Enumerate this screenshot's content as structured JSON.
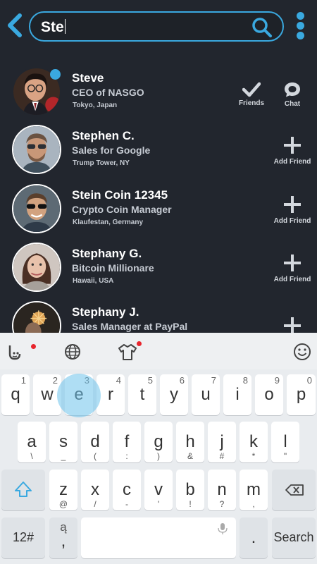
{
  "search": {
    "value": "Ste"
  },
  "contacts": [
    {
      "name": "Steve",
      "title": "CEO of NASGO",
      "location": "Tokyo, Japan",
      "actions": [
        {
          "icon": "check-icon",
          "label": "Friends"
        },
        {
          "icon": "chat-bubble-icon",
          "label": "Chat"
        }
      ],
      "online": true
    },
    {
      "name": "Stephen C.",
      "title": "Sales for Google",
      "location": "Trump Tower, NY",
      "actions": [
        {
          "icon": "plus-icon",
          "label": "Add Friend"
        }
      ]
    },
    {
      "name": "Stein Coin 12345",
      "title": "Crypto Coin Manager",
      "location": "Klaufestan, Germany",
      "actions": [
        {
          "icon": "plus-icon",
          "label": "Add Friend"
        }
      ]
    },
    {
      "name": "Stephany G.",
      "title": "Bitcoin Millionare",
      "location": "Hawaii, USA",
      "actions": [
        {
          "icon": "plus-icon",
          "label": "Add Friend"
        }
      ]
    },
    {
      "name": "Stephany J.",
      "title": "Sales Manager at PayPal",
      "location": "",
      "actions": [
        {
          "icon": "plus-icon",
          "label": ""
        }
      ]
    }
  ],
  "keyboard": {
    "row1": [
      {
        "key": "q",
        "num": "1"
      },
      {
        "key": "w",
        "num": "2"
      },
      {
        "key": "e",
        "num": "3"
      },
      {
        "key": "r",
        "num": "4"
      },
      {
        "key": "t",
        "num": "5"
      },
      {
        "key": "y",
        "num": "6"
      },
      {
        "key": "u",
        "num": "7"
      },
      {
        "key": "i",
        "num": "8"
      },
      {
        "key": "o",
        "num": "9"
      },
      {
        "key": "p",
        "num": "0"
      }
    ],
    "row2": [
      {
        "key": "a",
        "sub": "\\"
      },
      {
        "key": "s",
        "sub": "_"
      },
      {
        "key": "d",
        "sub": "("
      },
      {
        "key": "f",
        "sub": ":"
      },
      {
        "key": "g",
        "sub": ")"
      },
      {
        "key": "h",
        "sub": "&"
      },
      {
        "key": "j",
        "sub": "#"
      },
      {
        "key": "k",
        "sub": "*"
      },
      {
        "key": "l",
        "sub": "\""
      }
    ],
    "row3": [
      {
        "key": "z",
        "sub": "@"
      },
      {
        "key": "x",
        "sub": "/"
      },
      {
        "key": "c",
        "sub": "-"
      },
      {
        "key": "v",
        "sub": "'"
      },
      {
        "key": "b",
        "sub": "!"
      },
      {
        "key": "n",
        "sub": "?"
      },
      {
        "key": "m",
        "sub": ","
      }
    ],
    "symbols_label": "12#",
    "comma_key": ",",
    "period_key": ".",
    "action_label": "Search",
    "accent_color": "#3aa9e0"
  }
}
